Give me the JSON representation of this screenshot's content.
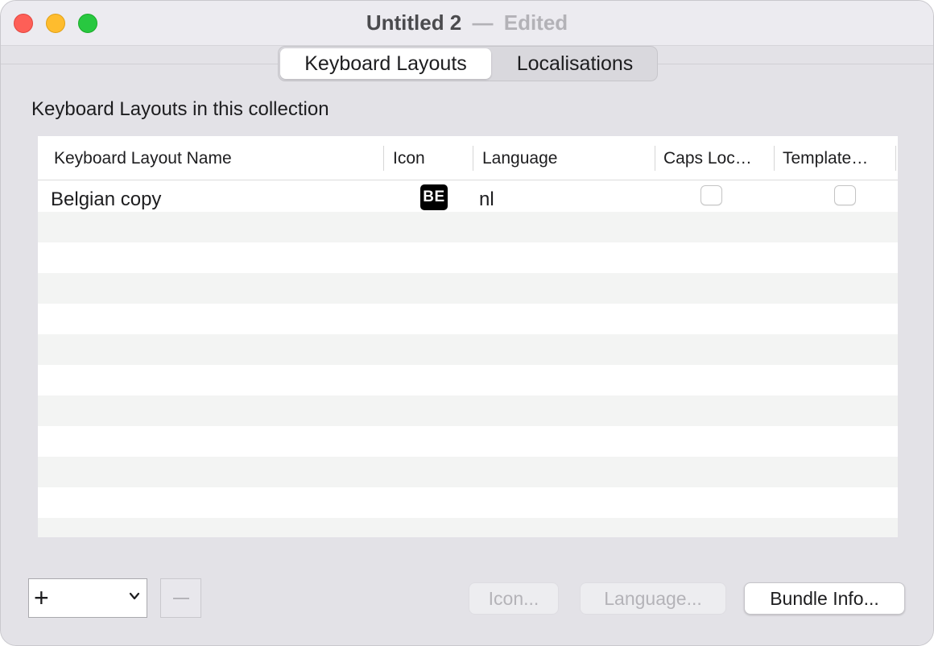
{
  "window": {
    "title": "Untitled 2",
    "separator": "—",
    "status": "Edited"
  },
  "tabs": [
    {
      "label": "Keyboard Layouts",
      "selected": true
    },
    {
      "label": "Localisations",
      "selected": false
    }
  ],
  "section_label": "Keyboard Layouts in this collection",
  "table": {
    "columns": [
      "Keyboard Layout Name",
      "Icon",
      "Language",
      "Caps Loc…",
      "Template…"
    ],
    "rows": [
      {
        "name": "Belgian copy",
        "icon": "BE",
        "language": "nl",
        "caps_lock": false,
        "template": false
      }
    ]
  },
  "footer": {
    "add_symbol": "+",
    "remove_symbol": "−",
    "icon_button": "Icon...",
    "language_button": "Language...",
    "bundle_info_button": "Bundle Info..."
  },
  "colors": {
    "close": "#fe5f57",
    "minimize": "#febc2e",
    "zoom": "#28c840",
    "stripe": "#f3f4f3"
  }
}
